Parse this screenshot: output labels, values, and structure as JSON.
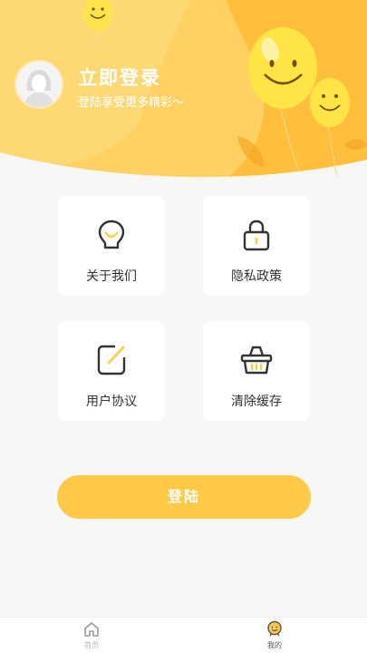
{
  "header": {
    "login_title": "立即登录",
    "login_subtitle": "登陆享受更多精彩～"
  },
  "menu": {
    "about": {
      "label": "关于我们",
      "icon": "bulb-icon"
    },
    "privacy": {
      "label": "隐私政策",
      "icon": "lock-icon"
    },
    "terms": {
      "label": "用户协议",
      "icon": "edit-icon"
    },
    "cache": {
      "label": "清除缓存",
      "icon": "basket-icon"
    }
  },
  "login_button": {
    "label": "登陆"
  },
  "tabbar": {
    "home": {
      "label": "首页",
      "icon": "home-icon",
      "active": false
    },
    "mine": {
      "label": "我的",
      "icon": "profile-smile-icon",
      "active": true
    }
  },
  "colors": {
    "accent": "#ffc94a",
    "header_yellow": "#ffcf56",
    "icon_stroke": "#333333",
    "icon_accent": "#ffc94a"
  }
}
